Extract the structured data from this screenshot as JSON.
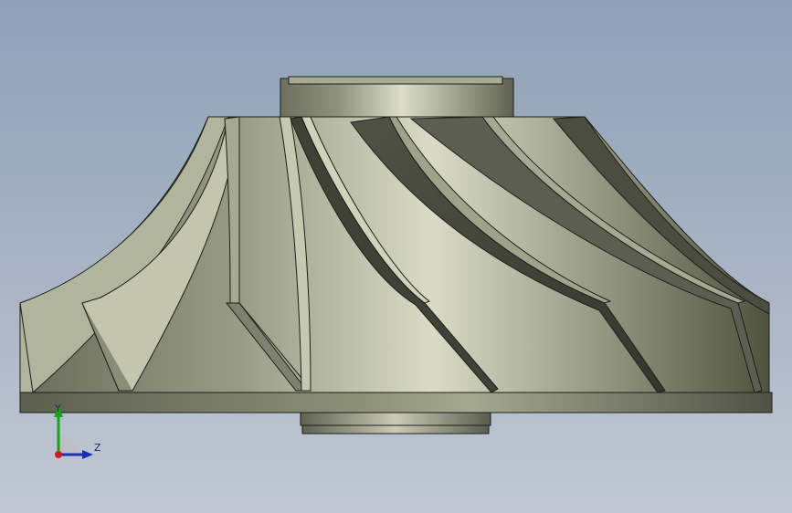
{
  "model": {
    "part": "impeller"
  },
  "colors": {
    "background_top": "#8fa0b7",
    "background_bottom": "#c1c8d3",
    "part_light": "#d7d9c2",
    "part_mid": "#9da08a",
    "part_dark": "#45483b",
    "edge": "#1d1e19",
    "axis_y": "#19a319",
    "axis_z": "#1b2fb5",
    "axis_x": "#d41a1a"
  },
  "triad": {
    "y_label": "Y",
    "z_label": "Z"
  }
}
